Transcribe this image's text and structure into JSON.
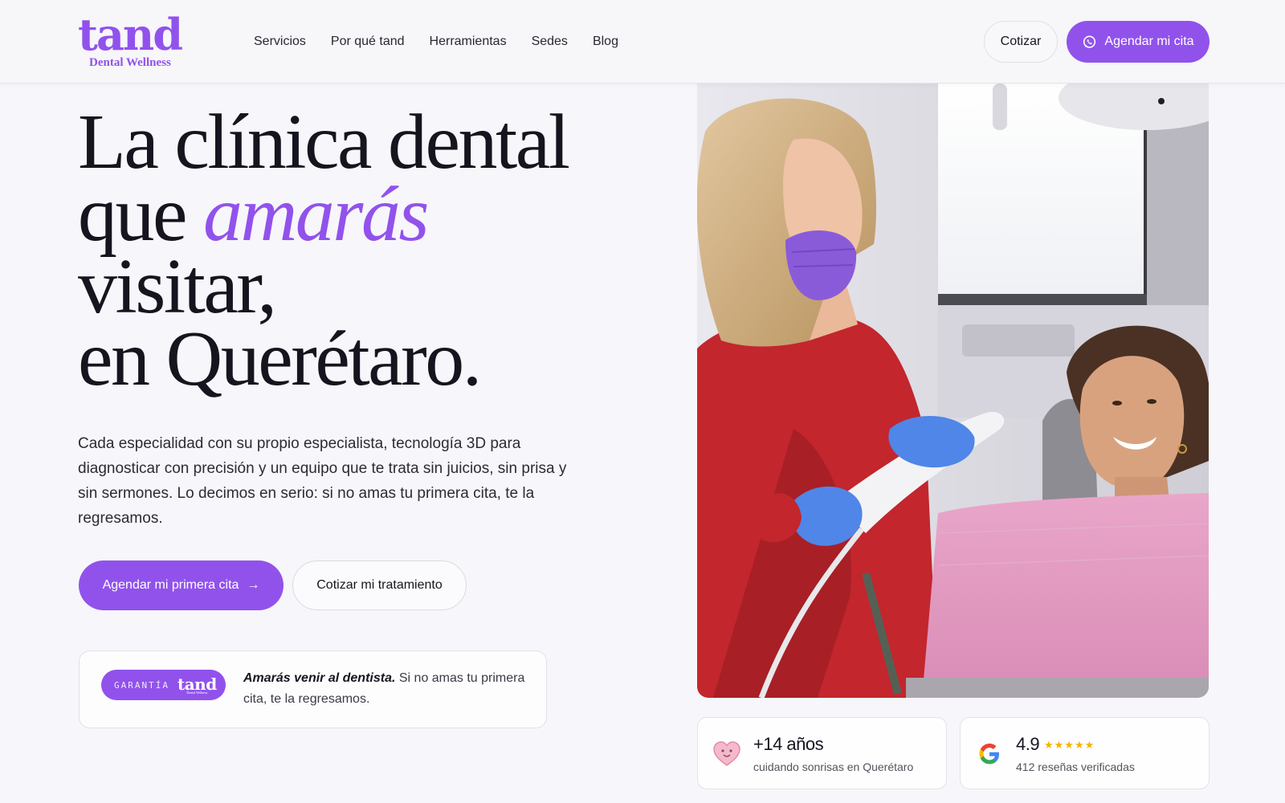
{
  "header": {
    "logo": {
      "word": "tand",
      "tagline": "Dental Wellness"
    },
    "nav": [
      "Servicios",
      "Por qué tand",
      "Herramientas",
      "Sedes",
      "Blog"
    ],
    "quote_button": "Cotizar",
    "book_button": "Agendar mi cita",
    "book_button_icon": "whatsapp-icon"
  },
  "hero": {
    "title_line1": "La clínica dental",
    "title_line2_prefix": "que ",
    "title_line2_accent": "amarás",
    "title_line3": "visitar,",
    "title_line4": "en Querétaro.",
    "description": "Cada especialidad con su propio especialista, tecnología 3D para diagnosticar con precisión y un equipo que te trata sin juicios, sin prisa y sin sermones. Lo decimos en serio: si no amas tu primera cita, te la regresamos.",
    "cta_primary": "Agendar mi primera cita",
    "cta_primary_arrow": "→",
    "cta_secondary": "Cotizar mi tratamiento",
    "guarantee": {
      "badge_label": "GARANTÍA",
      "badge_logo": "tand",
      "badge_logo_sub": "Dental Wellness",
      "lead": "Amarás venir al dentista.",
      "text": " Si no amas tu primera cita, te la regresamos."
    }
  },
  "stats": {
    "years": {
      "value": "+14 años",
      "caption": "cuidando sonrisas en Querétaro",
      "icon": "heart-icon"
    },
    "rating": {
      "value": "4.9",
      "stars": "★★★★★",
      "caption": "412 reseñas verificadas",
      "icon": "google-icon"
    }
  },
  "colors": {
    "brand": "#9152ec",
    "background": "#f7f6fa",
    "text": "#17151f",
    "star": "#f4b400"
  }
}
